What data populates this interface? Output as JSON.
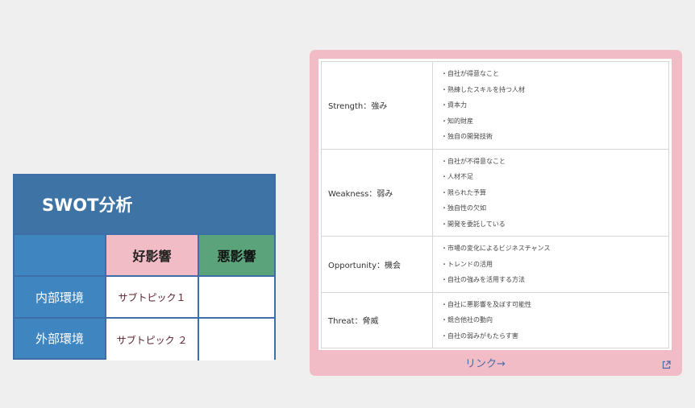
{
  "swot_grid": {
    "title": "SWOT分析",
    "col_good": "好影響",
    "col_bad": "悪影響",
    "rows": [
      {
        "label": "内部環境",
        "good": "サブトピック１",
        "bad": ""
      },
      {
        "label": "外部環境",
        "good": "サブトピック ２",
        "bad": ""
      }
    ]
  },
  "card": {
    "rows": [
      {
        "key": "Strength：強み",
        "items": [
          "・自社が得意なこと",
          "・熟練したスキルを持つ人材",
          "・資本力",
          "・知的財産",
          "・独自の開発技術"
        ]
      },
      {
        "key": "Weakness：弱み",
        "items": [
          "・自社が不得意なこと",
          "・人材不足",
          "・限られた予算",
          "・独自性の欠如",
          "・開発を委託している"
        ]
      },
      {
        "key": "Opportunity：機会",
        "items": [
          "・市場の変化によるビジネスチャンス",
          "・トレンドの活用",
          "・自社の強みを活用する方法"
        ]
      },
      {
        "key": "Threat：脅威",
        "items": [
          "・自社に悪影響を及ぼす可能性",
          "・競合他社の動向",
          "・自社の弱みがもたらす害"
        ]
      }
    ],
    "link_label": "リンク→",
    "external_icon": "external-link-icon"
  },
  "colors": {
    "grid_header": "#3d73a5",
    "grid_side": "#3f85c0",
    "good": "#f2bcc6",
    "bad": "#5ba37a",
    "card_bg": "#f2bcc6",
    "link": "#4a6aa8"
  }
}
